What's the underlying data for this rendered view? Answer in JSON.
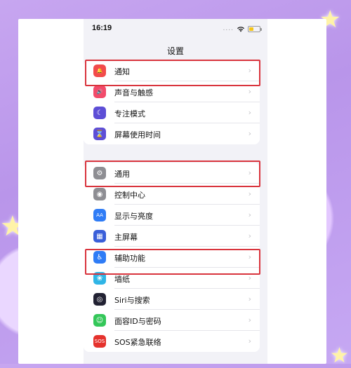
{
  "status_bar": {
    "time": "16:19",
    "signal": "....",
    "battery_color": "#f5c518"
  },
  "page_title": "设置",
  "group1": [
    {
      "label": "通知",
      "icon": "bell-icon",
      "color": "#f24b4b",
      "glyph": "🔔"
    },
    {
      "label": "声音与触感",
      "icon": "speaker-icon",
      "color": "#f24b6a",
      "glyph": "🔊"
    },
    {
      "label": "专注模式",
      "icon": "moon-icon",
      "color": "#5d4ed6",
      "glyph": "☾"
    },
    {
      "label": "屏幕使用时间",
      "icon": "hourglass-icon",
      "color": "#5d4ed6",
      "glyph": "⌛"
    }
  ],
  "group2": [
    {
      "label": "通用",
      "icon": "gear-icon",
      "color": "#8e8e93",
      "glyph": "⚙"
    },
    {
      "label": "控制中心",
      "icon": "toggles-icon",
      "color": "#8e8e93",
      "glyph": "◉"
    },
    {
      "label": "显示与亮度",
      "icon": "display-aa-icon",
      "color": "#2f7cf6",
      "glyph": "AA"
    },
    {
      "label": "主屏幕",
      "icon": "home-grid-icon",
      "color": "#3a5fd9",
      "glyph": "▦"
    },
    {
      "label": "辅助功能",
      "icon": "accessibility-icon",
      "color": "#2f7cf6",
      "glyph": "♿"
    },
    {
      "label": "墙纸",
      "icon": "flower-icon",
      "color": "#2fb5e6",
      "glyph": "❀"
    },
    {
      "label": "Siri与搜索",
      "icon": "siri-icon",
      "color": "#222233",
      "glyph": "◎"
    },
    {
      "label": "面容ID与密码",
      "icon": "faceid-icon",
      "color": "#34c759",
      "glyph": "☺"
    },
    {
      "label": "SOS紧急联络",
      "icon": "sos-icon",
      "color": "#e5322d",
      "glyph": "SOS"
    }
  ],
  "chevron": "›",
  "highlight_color": "#d9343d"
}
